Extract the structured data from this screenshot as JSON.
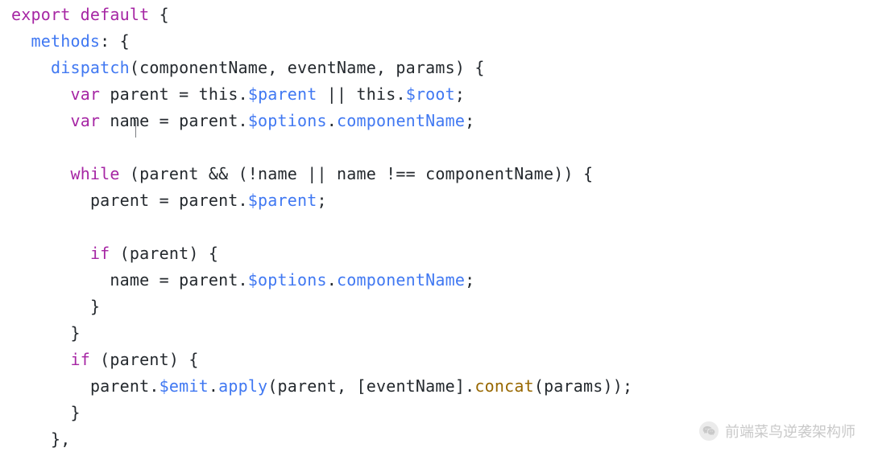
{
  "code": {
    "lines": [
      {
        "indent": 0,
        "tokens": [
          [
            "kw",
            "export default"
          ],
          [
            "pun",
            " {"
          ]
        ]
      },
      {
        "indent": 1,
        "tokens": [
          [
            "id",
            "methods"
          ],
          [
            "pun",
            ": {"
          ]
        ]
      },
      {
        "indent": 2,
        "tokens": [
          [
            "id",
            "dispatch"
          ],
          [
            "pun",
            "(componentName, eventName, params) {"
          ]
        ]
      },
      {
        "indent": 3,
        "tokens": [
          [
            "kw",
            "var"
          ],
          [
            "pun",
            " parent = "
          ],
          [
            "th",
            "this"
          ],
          [
            "pun",
            "."
          ],
          [
            "dol",
            "$parent"
          ],
          [
            "pun",
            " || "
          ],
          [
            "th",
            "this"
          ],
          [
            "pun",
            "."
          ],
          [
            "dol",
            "$root"
          ],
          [
            "pun",
            ";"
          ]
        ]
      },
      {
        "indent": 3,
        "tokens": [
          [
            "kw",
            "var"
          ],
          [
            "pun",
            " name = parent."
          ],
          [
            "dol",
            "$options"
          ],
          [
            "pun",
            "."
          ],
          [
            "prop",
            "componentName"
          ],
          [
            "pun",
            ";"
          ]
        ]
      },
      {
        "indent": 0,
        "tokens": [
          [
            "pun",
            ""
          ]
        ]
      },
      {
        "indent": 3,
        "tokens": [
          [
            "kw",
            "while"
          ],
          [
            "pun",
            " (parent && (!name || name !== componentName)) {"
          ]
        ]
      },
      {
        "indent": 4,
        "tokens": [
          [
            "pun",
            "parent = parent."
          ],
          [
            "dol",
            "$parent"
          ],
          [
            "pun",
            ";"
          ]
        ]
      },
      {
        "indent": 0,
        "tokens": [
          [
            "pun",
            ""
          ]
        ]
      },
      {
        "indent": 4,
        "tokens": [
          [
            "kw",
            "if"
          ],
          [
            "pun",
            " (parent) {"
          ]
        ]
      },
      {
        "indent": 5,
        "tokens": [
          [
            "pun",
            "name = parent."
          ],
          [
            "dol",
            "$options"
          ],
          [
            "pun",
            "."
          ],
          [
            "prop",
            "componentName"
          ],
          [
            "pun",
            ";"
          ]
        ]
      },
      {
        "indent": 4,
        "tokens": [
          [
            "pun",
            "}"
          ]
        ]
      },
      {
        "indent": 3,
        "tokens": [
          [
            "pun",
            "}"
          ]
        ]
      },
      {
        "indent": 3,
        "tokens": [
          [
            "kw",
            "if"
          ],
          [
            "pun",
            " (parent) {"
          ]
        ]
      },
      {
        "indent": 4,
        "tokens": [
          [
            "pun",
            "parent."
          ],
          [
            "dol",
            "$emit"
          ],
          [
            "pun",
            "."
          ],
          [
            "id",
            "apply"
          ],
          [
            "pun",
            "(parent, [eventName]."
          ],
          [
            "con",
            "concat"
          ],
          [
            "pun",
            "(params));"
          ]
        ]
      },
      {
        "indent": 3,
        "tokens": [
          [
            "pun",
            "}"
          ]
        ]
      },
      {
        "indent": 2,
        "tokens": [
          [
            "pun",
            "},"
          ]
        ]
      }
    ],
    "indent_unit": "  "
  },
  "watermark": {
    "text": "前端菜鸟逆袭架构师"
  }
}
